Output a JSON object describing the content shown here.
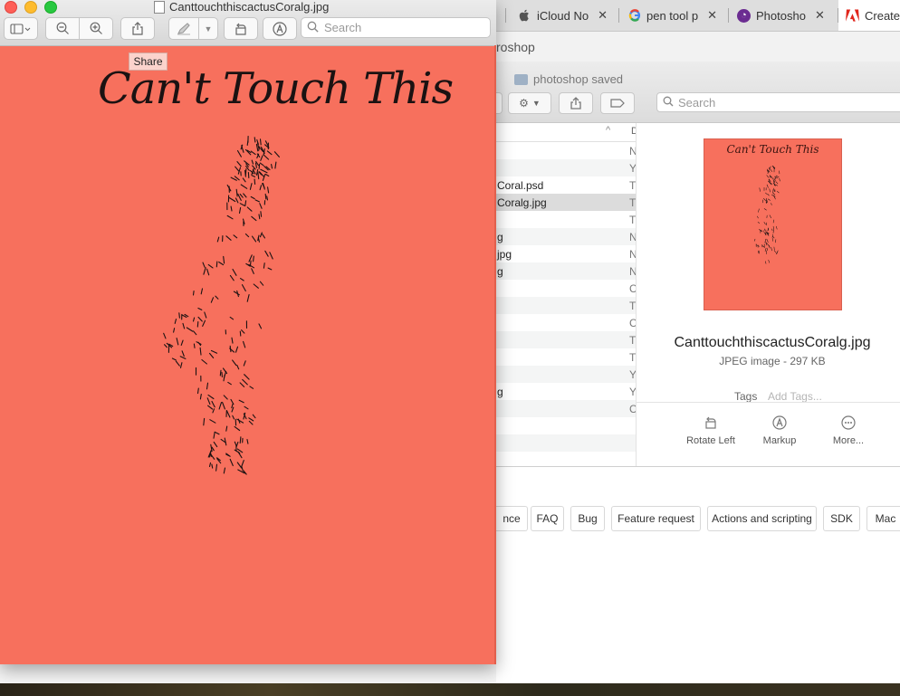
{
  "preview_window": {
    "title": "CanttouchthiscactusCoralg.jpg",
    "search_placeholder": "Search",
    "tooltip": "Share",
    "document_title": "Can't Touch This"
  },
  "browser": {
    "tabs": [
      {
        "label": "iCloud No",
        "favicon": "apple-icon"
      },
      {
        "label": "pen tool p",
        "favicon": "google-icon"
      },
      {
        "label": "Photosho",
        "favicon": "photoshop-community-icon"
      },
      {
        "label": "Create",
        "favicon": "adobe-icon"
      }
    ],
    "partial_header": "roshop",
    "tags": [
      "nce",
      "FAQ",
      "Bug",
      "Feature request",
      "Actions and scripting",
      "SDK",
      "Mac"
    ]
  },
  "finder": {
    "folder": "photoshop saved",
    "search_placeholder": "Search",
    "column_header": "D",
    "rows": [
      {
        "name": "",
        "kind": "N"
      },
      {
        "name": "",
        "kind": "Y"
      },
      {
        "name": "Coral.psd",
        "kind": "T"
      },
      {
        "name": "Coralg.jpg",
        "kind": "T",
        "selected": true
      },
      {
        "name": "",
        "kind": "T"
      },
      {
        "name": "g",
        "kind": "N"
      },
      {
        "name": "jpg",
        "kind": "N"
      },
      {
        "name": "g",
        "kind": "N"
      },
      {
        "name": "",
        "kind": "C"
      },
      {
        "name": "",
        "kind": "T"
      },
      {
        "name": "",
        "kind": "C"
      },
      {
        "name": "",
        "kind": "T"
      },
      {
        "name": "",
        "kind": "T"
      },
      {
        "name": "",
        "kind": "Y"
      },
      {
        "name": "g",
        "kind": "Y"
      },
      {
        "name": "",
        "kind": "C"
      },
      {
        "name": "",
        "kind": ""
      },
      {
        "name": "",
        "kind": ""
      }
    ],
    "preview": {
      "thumbnail_title": "Can't Touch This",
      "file_name": "CanttouchthiscactusCoralg.jpg",
      "file_kind": "JPEG image - 297 KB",
      "tags_label": "Tags",
      "tags_placeholder": "Add Tags...",
      "actions": [
        {
          "label": "Rotate Left",
          "icon": "rotate-left-icon"
        },
        {
          "label": "Markup",
          "icon": "markup-icon"
        },
        {
          "label": "More...",
          "icon": "more-icon"
        }
      ]
    }
  },
  "colors": {
    "coral": "#f7705d",
    "ink": "#1b1212"
  }
}
